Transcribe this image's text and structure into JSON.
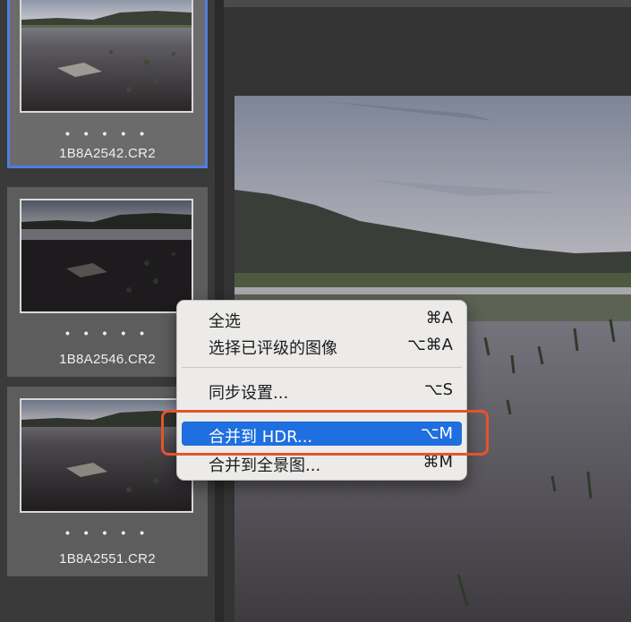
{
  "filmstrip": {
    "items": [
      {
        "filename": "1B8A2542.CR2",
        "rating_dots": "• • • • •",
        "selected": true
      },
      {
        "filename": "1B8A2546.CR2",
        "rating_dots": "• • • • •",
        "selected": false
      },
      {
        "filename": "1B8A2551.CR2",
        "rating_dots": "• • • • •",
        "selected": false
      }
    ]
  },
  "context_menu": {
    "items": [
      {
        "label": "全选",
        "shortcut": "⌘A"
      },
      {
        "label": "选择已评级的图像",
        "shortcut": "⌥⌘A"
      },
      {
        "label": "同步设置...",
        "shortcut": "⌥S"
      },
      {
        "label": "合并到 HDR...",
        "shortcut": "⌥M",
        "highlighted": true
      },
      {
        "label": "合并到全景图...",
        "shortcut": "⌘M"
      }
    ]
  },
  "colors": {
    "selection_border": "#4d7ee0",
    "menu_highlight": "#1f6fe0",
    "annotation": "#e4542a"
  }
}
